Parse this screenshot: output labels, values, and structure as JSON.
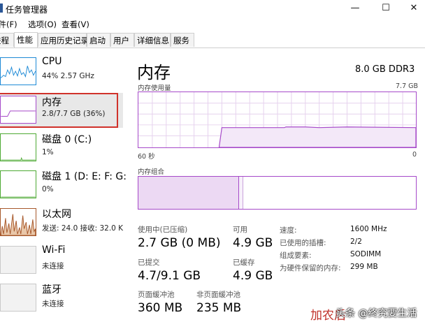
{
  "window": {
    "title": "任务管理器",
    "minimize_glyph": "—",
    "maximize_glyph": "☐",
    "close_glyph": "✕"
  },
  "menu": [
    "文件(F)",
    "选项(O)",
    "查看(V)"
  ],
  "tabs": [
    {
      "label": "进程",
      "active": false
    },
    {
      "label": "性能",
      "active": true
    },
    {
      "label": "应用历史记录",
      "active": false
    },
    {
      "label": "启动",
      "active": false
    },
    {
      "label": "用户",
      "active": false
    },
    {
      "label": "详细信息",
      "active": false
    },
    {
      "label": "服务",
      "active": false
    }
  ],
  "sidebar": {
    "items": [
      {
        "name": "CPU",
        "detail": "44% 2.57 GHz",
        "icon": "cpu-graph-icon",
        "color": "#1e8ad6"
      },
      {
        "name": "内存",
        "detail": "2.8/7.7 GB (36%)",
        "icon": "memory-graph-icon",
        "color": "#a64ac9",
        "selected": true
      },
      {
        "name": "磁盘 0 (C:)",
        "detail": "1%",
        "icon": "disk-graph-icon",
        "color": "#4da933"
      },
      {
        "name": "磁盘 1 (D: E: F: G:",
        "detail": "0%",
        "icon": "disk-graph-icon",
        "color": "#4da933"
      },
      {
        "name": "以太网",
        "detail": "发送: 24.0  接收: 32.0 K",
        "icon": "ethernet-graph-icon",
        "color": "#a7582b"
      },
      {
        "name": "Wi-Fi",
        "detail": "未连接",
        "icon": "wifi-graph-icon",
        "color": "#a7582b"
      },
      {
        "name": "蓝牙",
        "detail": "未连接",
        "icon": "bluetooth-graph-icon",
        "color": "#a7582b"
      }
    ]
  },
  "main": {
    "title": "内存",
    "spec": "8.0 GB DDR3",
    "usage_label": "内存使用量",
    "usage_max": "7.7 GB",
    "time_left": "60 秒",
    "time_right": "0",
    "composition_label": "内存组合",
    "usage_fraction": 0.36,
    "stats": [
      {
        "label": "使用中(已压缩)",
        "value": "2.7 GB (0 MB)"
      },
      {
        "label": "可用",
        "value": "4.9 GB"
      },
      {
        "label": "已提交",
        "value": "4.7/9.1 GB"
      },
      {
        "label": "已缓存",
        "value": "4.9 GB"
      },
      {
        "label": "页面缓冲池",
        "value": "360 MB"
      },
      {
        "label": "非页面缓冲池",
        "value": "235 MB"
      }
    ],
    "specs": [
      {
        "label": "速度:",
        "value": "1600 MHz"
      },
      {
        "label": "已使用的插槽:",
        "value": "2/2"
      },
      {
        "label": "组成要素:",
        "value": "SODIMM"
      },
      {
        "label": "为硬件保留的内存:",
        "value": "299 MB"
      }
    ]
  },
  "watermark": {
    "text1": "加农后",
    "text2": "头条 @终究要生活"
  }
}
